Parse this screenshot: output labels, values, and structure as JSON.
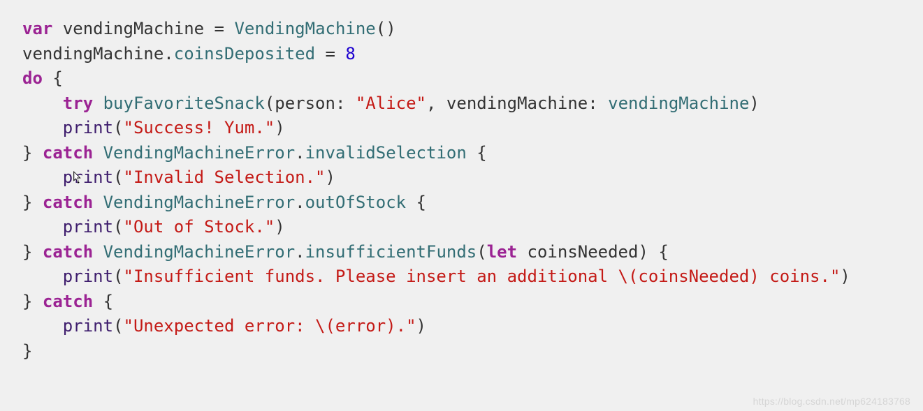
{
  "code": {
    "l1": {
      "var": "var",
      "ident": "vendingMachine",
      "eq": " = ",
      "type": "VendingMachine",
      "parens": "()"
    },
    "l2": {
      "obj": "vendingMachine",
      "dot": ".",
      "prop": "coinsDeposited",
      "eq": " = ",
      "num": "8"
    },
    "l3": {
      "do": "do",
      "brace": " {"
    },
    "l4": {
      "indent": "    ",
      "try": "try",
      "sp": " ",
      "fn": "buyFavoriteSnack",
      "open": "(",
      "arg1lbl": "person",
      "colon1": ": ",
      "arg1val": "\"Alice\"",
      "comma": ", ",
      "arg2lbl": "vendingMachine",
      "colon2": ": ",
      "arg2val": "vendingMachine",
      "close": ")"
    },
    "l5": {
      "indent": "    ",
      "fn": "print",
      "open": "(",
      "str": "\"Success! Yum.\"",
      "close": ")"
    },
    "l6": {
      "closebrace": "} ",
      "catch": "catch",
      "sp": " ",
      "errtype": "VendingMachineError",
      "dot": ".",
      "case": "invalidSelection",
      "brace": " {"
    },
    "l7": {
      "indent": "    ",
      "fn": "print",
      "open": "(",
      "str": "\"Invalid Selection.\"",
      "close": ")"
    },
    "l8": {
      "closebrace": "} ",
      "catch": "catch",
      "sp": " ",
      "errtype": "VendingMachineError",
      "dot": ".",
      "case": "outOfStock",
      "brace": " {"
    },
    "l9": {
      "indent": "    ",
      "fn": "print",
      "open": "(",
      "str": "\"Out of Stock.\"",
      "close": ")"
    },
    "l10": {
      "closebrace": "} ",
      "catch": "catch",
      "sp": " ",
      "errtype": "VendingMachineError",
      "dot": ".",
      "case": "insufficientFunds",
      "open": "(",
      "let": "let",
      "sp2": " ",
      "bind": "coinsNeeded",
      "close": ")",
      "brace": " {"
    },
    "l11": {
      "indent": "    ",
      "fn": "print",
      "open": "(",
      "str": "\"Insufficient funds. Please insert an additional \\(coinsNeeded) coins.\"",
      "close": ")"
    },
    "l12": {
      "closebrace": "} ",
      "catch": "catch",
      "brace": " {"
    },
    "l13": {
      "indent": "    ",
      "fn": "print",
      "open": "(",
      "str": "\"Unexpected error: \\(error).\"",
      "close": ")"
    },
    "l14": {
      "brace": "}"
    }
  },
  "watermark": "https://blog.csdn.net/mp624183768"
}
